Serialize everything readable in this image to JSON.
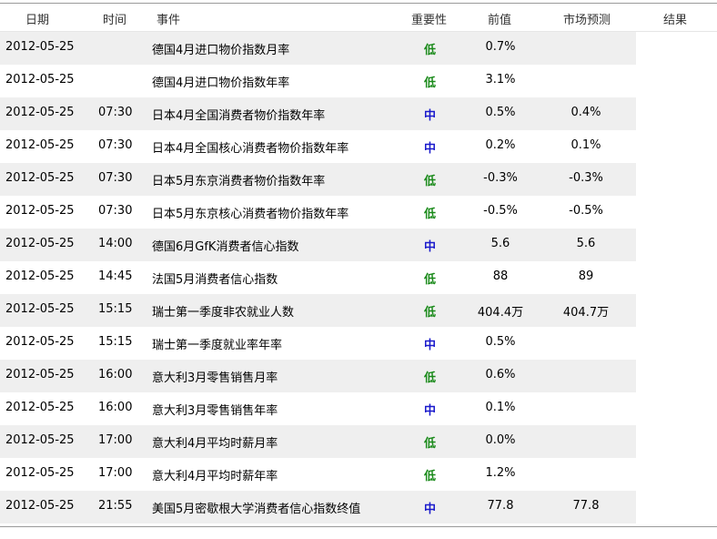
{
  "header": {
    "date": "日期",
    "time": "时间",
    "event": "事件",
    "importance": "重要性",
    "previous": "前值",
    "forecast": "市场预测",
    "result": "结果"
  },
  "colors": {
    "low": "#1a8a1a",
    "medium": "#1a1acc"
  },
  "rows": [
    {
      "date": "2012-05-25",
      "time": "",
      "event": "德国4月进口物价指数月率",
      "importance": "低",
      "level": "low",
      "previous": "0.7%",
      "forecast": ""
    },
    {
      "date": "2012-05-25",
      "time": "",
      "event": "德国4月进口物价指数年率",
      "importance": "低",
      "level": "low",
      "previous": "3.1%",
      "forecast": ""
    },
    {
      "date": "2012-05-25",
      "time": "07:30",
      "event": "日本4月全国消费者物价指数年率",
      "importance": "中",
      "level": "medium",
      "previous": "0.5%",
      "forecast": "0.4%"
    },
    {
      "date": "2012-05-25",
      "time": "07:30",
      "event": "日本4月全国核心消费者物价指数年率",
      "importance": "中",
      "level": "medium",
      "previous": "0.2%",
      "forecast": "0.1%"
    },
    {
      "date": "2012-05-25",
      "time": "07:30",
      "event": "日本5月东京消费者物价指数年率",
      "importance": "低",
      "level": "low",
      "previous": "-0.3%",
      "forecast": "-0.3%"
    },
    {
      "date": "2012-05-25",
      "time": "07:30",
      "event": "日本5月东京核心消费者物价指数年率",
      "importance": "低",
      "level": "low",
      "previous": "-0.5%",
      "forecast": "-0.5%"
    },
    {
      "date": "2012-05-25",
      "time": "14:00",
      "event": "德国6月GfK消费者信心指数",
      "importance": "中",
      "level": "medium",
      "previous": "5.6",
      "forecast": "5.6"
    },
    {
      "date": "2012-05-25",
      "time": "14:45",
      "event": "法国5月消费者信心指数",
      "importance": "低",
      "level": "low",
      "previous": "88",
      "forecast": "89"
    },
    {
      "date": "2012-05-25",
      "time": "15:15",
      "event": "瑞士第一季度非农就业人数",
      "importance": "低",
      "level": "low",
      "previous": "404.4万",
      "forecast": "404.7万"
    },
    {
      "date": "2012-05-25",
      "time": "15:15",
      "event": "瑞士第一季度就业率年率",
      "importance": "中",
      "level": "medium",
      "previous": "0.5%",
      "forecast": ""
    },
    {
      "date": "2012-05-25",
      "time": "16:00",
      "event": "意大利3月零售销售月率",
      "importance": "低",
      "level": "low",
      "previous": "0.6%",
      "forecast": ""
    },
    {
      "date": "2012-05-25",
      "time": "16:00",
      "event": "意大利3月零售销售年率",
      "importance": "中",
      "level": "medium",
      "previous": "0.1%",
      "forecast": ""
    },
    {
      "date": "2012-05-25",
      "time": "17:00",
      "event": "意大利4月平均时薪月率",
      "importance": "低",
      "level": "low",
      "previous": "0.0%",
      "forecast": ""
    },
    {
      "date": "2012-05-25",
      "time": "17:00",
      "event": "意大利4月平均时薪年率",
      "importance": "低",
      "level": "low",
      "previous": "1.2%",
      "forecast": ""
    },
    {
      "date": "2012-05-25",
      "time": "21:55",
      "event": "美国5月密歇根大学消费者信心指数终值",
      "importance": "中",
      "level": "medium",
      "previous": "77.8",
      "forecast": "77.8"
    }
  ]
}
